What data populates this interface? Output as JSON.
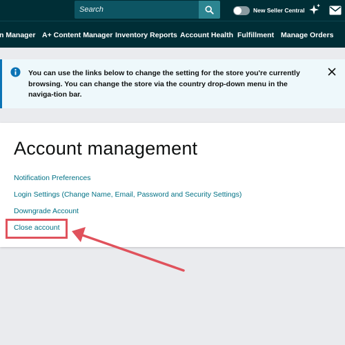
{
  "header": {
    "search": {
      "placeholder": "Search",
      "value": ""
    },
    "toggle_label": "New Seller Central"
  },
  "nav": {
    "items": [
      "n Manager",
      "A+ Content Manager",
      "Inventory Reports",
      "Account Health",
      "Fulfillment",
      "Manage Orders"
    ]
  },
  "banner": {
    "message": "You can use the links below to change the setting for the store you're currently browsing. You can change the store via the country drop-down menu in the naviga-tion bar."
  },
  "account": {
    "title": "Account management",
    "links": [
      "Notification Preferences",
      "Login Settings (Change Name, Email, Password and Security Settings)",
      "Downgrade Account",
      "Close account"
    ]
  },
  "colors": {
    "header_bg": "#002e36",
    "link": "#007185",
    "info_accent": "#0b73b5",
    "highlight": "#e0525c"
  },
  "icons": [
    "search-icon",
    "sparkle-icon",
    "mail-icon",
    "info-icon",
    "close-icon"
  ]
}
